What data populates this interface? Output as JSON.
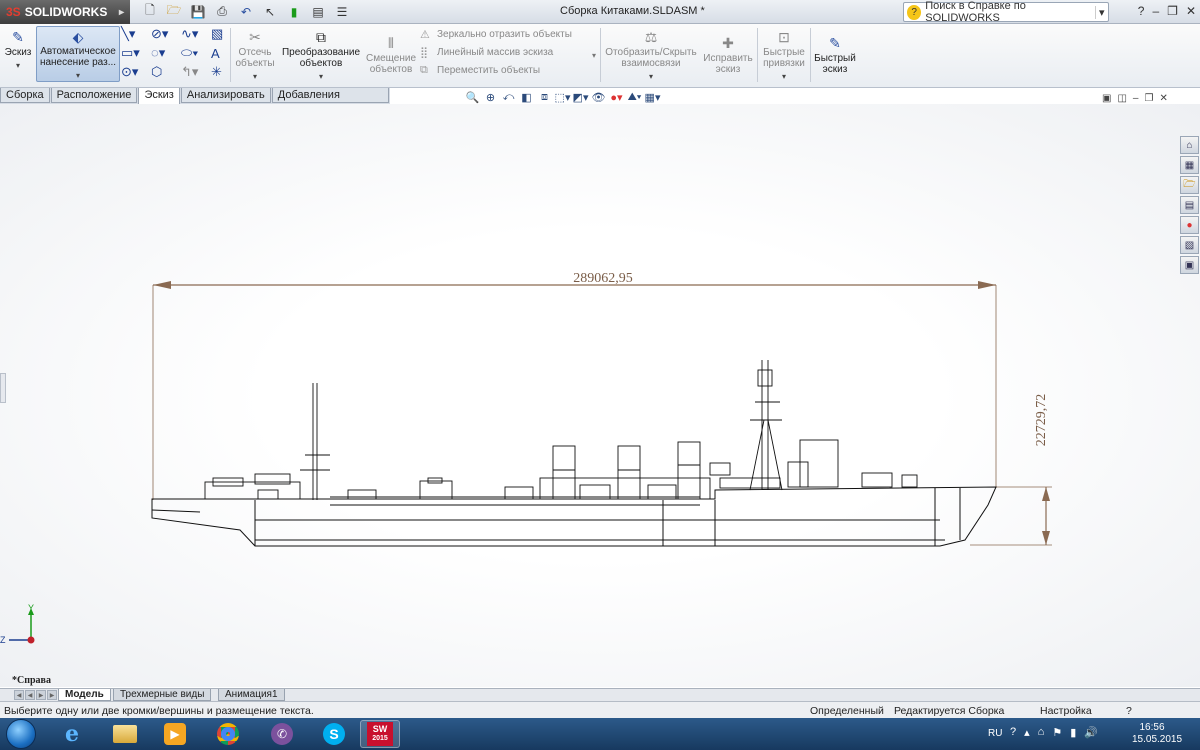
{
  "app": {
    "brand": "SOLIDWORKS",
    "document_title": "Сборка Китаками.SLDASM *",
    "help_search_placeholder": "Поиск в Справке по SOLIDWORKS"
  },
  "command_manager": {
    "sketch": "Эскиз",
    "smart_dimension": "Автоматическое нанесение раз...",
    "trim": "Отсечь объекты",
    "convert": "Преобразование объектов",
    "offset": "Смещение объектов",
    "mirror": "Зеркально отразить объекты",
    "linear_pattern": "Линейный массив эскиза",
    "move": "Переместить объекты",
    "show_relations": "Отобразить/Скрыть взаимосвязи",
    "repair": "Исправить эскиз",
    "quick_snaps": "Быстрые привязки",
    "rapid_sketch": "Быстрый эскиз"
  },
  "tabs": [
    {
      "label": "Сборка"
    },
    {
      "label": "Расположение"
    },
    {
      "label": "Эскиз"
    },
    {
      "label": "Анализировать"
    },
    {
      "label": "Добавления SOLIDWORKS"
    }
  ],
  "active_tab": "Эскиз",
  "graphics": {
    "dim_length": "289062,95",
    "dim_height": "22729,72",
    "view_name": "*Справа",
    "triad_y": "Y",
    "triad_z": "Z"
  },
  "model_tabs": [
    {
      "label": "Модель"
    },
    {
      "label": "Трехмерные виды"
    },
    {
      "label": "Анимация1"
    }
  ],
  "status_bar": {
    "prompt": "Выберите одну или две кромки/вершины и размещение текста.",
    "state": "Определенный",
    "mode": "Редактируется Сборка",
    "settings": "Настройка"
  },
  "taskbar": {
    "sw_badge": "2015",
    "lang": "RU",
    "time": "16:56",
    "date": "15.05.2015"
  },
  "colors": {
    "dimension": "#8a6a52",
    "ship_line": "#111111",
    "accent": "#e43d30",
    "taskbar": "#1f4a78"
  }
}
